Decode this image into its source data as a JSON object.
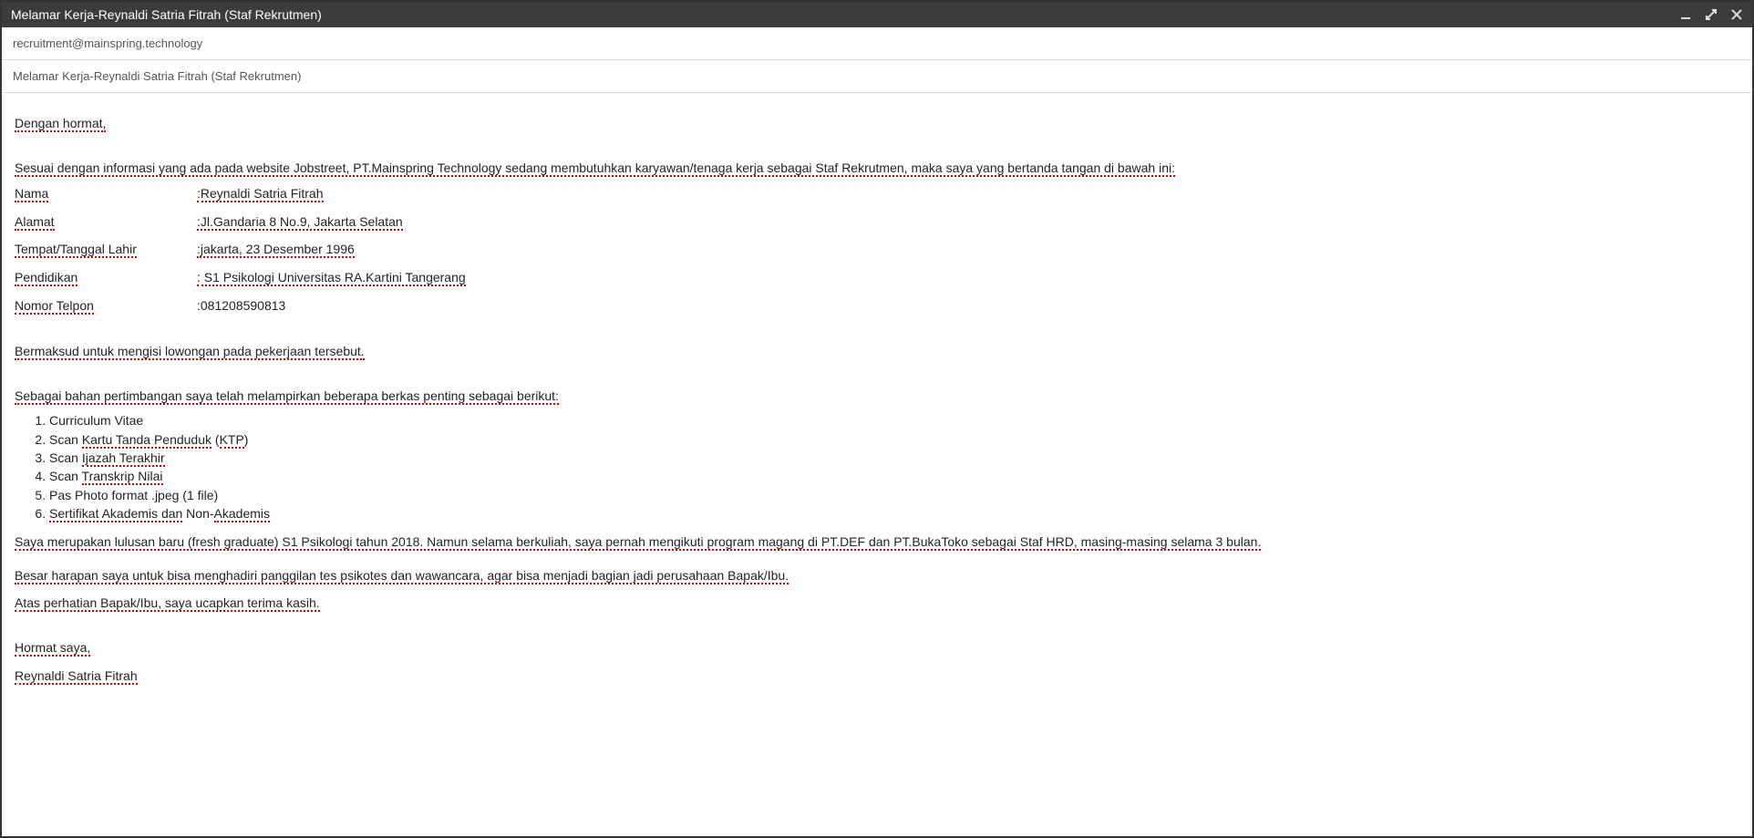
{
  "window": {
    "title": "Melamar Kerja-Reynaldi Satria Fitrah (Staf Rekrutmen)"
  },
  "header": {
    "to": "recruitment@mainspring.technology",
    "subject": "Melamar Kerja-Reynaldi Satria Fitrah (Staf Rekrutmen)"
  },
  "body": {
    "greeting": "Dengan hormat,",
    "intro": "Sesuai dengan informasi yang ada pada website Jobstreet, PT.Mainspring Technology sedang membutuhkan karyawan/tenaga kerja sebagai Staf Rekrutmen, maka saya yang bertanda tangan di bawah ini:",
    "info": {
      "nama_label": "Nama",
      "nama_value": ":Reynaldi Satria Fitrah",
      "alamat_label": "Alamat",
      "alamat_value": ":Jl.Gandaria 8 No.9, Jakarta Selatan",
      "ttl_label": "Tempat/Tanggal Lahir",
      "ttl_value": ":jakarta, 23 Desember 1996",
      "pendidikan_label": "Pendidikan",
      "pendidikan_value": ": S1 Psikologi Universitas RA.Kartini Tangerang",
      "telp_label": "Nomor Telpon",
      "telp_value": ":081208590813"
    },
    "intent": "Bermaksud untuk mengisi lowongan pada pekerjaan tersebut.",
    "attach_intro": "Sebagai bahan pertimbangan saya telah melampirkan beberapa berkas penting sebagai berikut:",
    "attachments": [
      "Curriculum Vitae",
      "Scan Kartu Tanda Penduduk (KTP)",
      "Scan Ijazah Terakhir",
      "Scan Transkrip Nilai",
      "Pas Photo format .jpeg (1 file)",
      "Sertifikat Akademis dan Non-Akademis"
    ],
    "exp": "Saya merupakan lulusan baru (fresh graduate) S1 Psikologi tahun 2018. Namun selama berkuliah, saya pernah mengikuti program magang di PT.DEF dan PT.BukaToko sebagai Staf HRD, masing-masing selama 3 bulan.",
    "hope": "Besar harapan saya untuk bisa menghadiri panggilan tes psikotes dan wawancara, agar bisa menjadi bagian jadi perusahaan Bapak/Ibu.",
    "thanks": "Atas perhatian Bapak/Ibu, saya ucapkan terima kasih.",
    "closing": "Hormat saya,",
    "signature": "Reynaldi Satria Fitrah"
  }
}
